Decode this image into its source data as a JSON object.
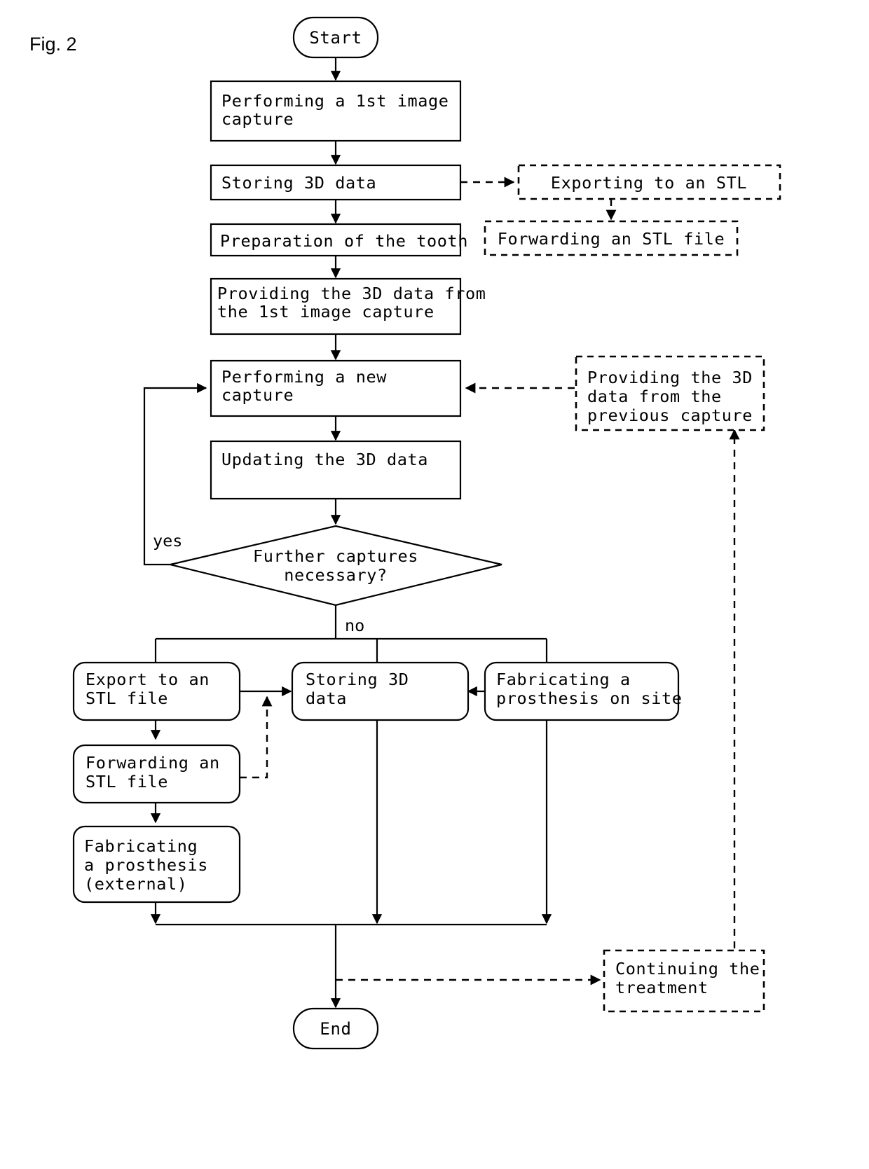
{
  "figure": {
    "label": "Fig. 2",
    "type": "flowchart",
    "title": "Dental 3D capture and prosthesis fabrication workflow"
  },
  "nodes": {
    "start": {
      "label": "Start",
      "shape": "terminator",
      "style": "solid"
    },
    "first_capture": {
      "label": "Performing a 1st image\ncapture",
      "shape": "process",
      "style": "solid"
    },
    "storing_1": {
      "label": "Storing 3D data",
      "shape": "process",
      "style": "solid"
    },
    "exporting_stl": {
      "label": "Exporting to an STL",
      "shape": "process",
      "style": "dashed"
    },
    "preparation": {
      "label": "Preparation of the tooth",
      "shape": "process",
      "style": "solid"
    },
    "forwarding_stl_top": {
      "label": "Forwarding an STL file",
      "shape": "process",
      "style": "dashed"
    },
    "providing_first": {
      "label": "Providing the 3D data from\nthe 1st image capture",
      "shape": "process",
      "style": "solid"
    },
    "new_capture": {
      "label": "Performing a new\ncapture",
      "shape": "process",
      "style": "solid"
    },
    "providing_previous": {
      "label": "Providing the 3D\ndata from the\nprevious capture",
      "shape": "process",
      "style": "dashed"
    },
    "updating": {
      "label": "Updating the 3D data",
      "shape": "process",
      "style": "solid"
    },
    "decision": {
      "label": "Further captures\nnecessary?",
      "shape": "decision",
      "style": "solid"
    },
    "export_stl": {
      "label": "Export to an\nSTL file",
      "shape": "rounded",
      "style": "solid"
    },
    "storing_2": {
      "label": "Storing 3D\ndata",
      "shape": "rounded",
      "style": "solid"
    },
    "fabricating_onsite": {
      "label": "Fabricating a\nprosthesis on site",
      "shape": "rounded",
      "style": "solid"
    },
    "forwarding_stl_bottom": {
      "label": "Forwarding an\nSTL file",
      "shape": "rounded",
      "style": "solid"
    },
    "fabricating_external": {
      "label": "Fabricating\na prosthesis\n(external)",
      "shape": "rounded",
      "style": "solid"
    },
    "continuing": {
      "label": "Continuing the\ntreatment",
      "shape": "process",
      "style": "dashed"
    },
    "end": {
      "label": "End",
      "shape": "terminator",
      "style": "solid"
    }
  },
  "edge_labels": {
    "yes": "yes",
    "no": "no"
  },
  "edges": [
    {
      "from": "start",
      "to": "first_capture",
      "style": "solid"
    },
    {
      "from": "first_capture",
      "to": "storing_1",
      "style": "solid"
    },
    {
      "from": "storing_1",
      "to": "exporting_stl",
      "style": "dashed"
    },
    {
      "from": "storing_1",
      "to": "preparation",
      "style": "solid"
    },
    {
      "from": "exporting_stl",
      "to": "forwarding_stl_top",
      "style": "dashed"
    },
    {
      "from": "preparation",
      "to": "providing_first",
      "style": "solid"
    },
    {
      "from": "providing_first",
      "to": "new_capture",
      "style": "solid"
    },
    {
      "from": "providing_previous",
      "to": "new_capture",
      "style": "dashed"
    },
    {
      "from": "new_capture",
      "to": "updating",
      "style": "solid"
    },
    {
      "from": "updating",
      "to": "decision",
      "style": "solid"
    },
    {
      "from": "decision",
      "to": "new_capture",
      "label": "yes",
      "style": "solid"
    },
    {
      "from": "decision",
      "to": "export_stl",
      "label": "no",
      "style": "solid"
    },
    {
      "from": "decision",
      "to": "storing_2",
      "label": "no",
      "style": "solid"
    },
    {
      "from": "decision",
      "to": "fabricating_onsite",
      "label": "no",
      "style": "solid"
    },
    {
      "from": "export_stl",
      "to": "storing_2",
      "style": "solid"
    },
    {
      "from": "export_stl",
      "to": "forwarding_stl_bottom",
      "style": "solid"
    },
    {
      "from": "forwarding_stl_bottom",
      "to": "storing_2",
      "style": "dashed"
    },
    {
      "from": "forwarding_stl_bottom",
      "to": "fabricating_external",
      "style": "solid"
    },
    {
      "from": "fabricating_onsite",
      "to": "storing_2",
      "style": "solid"
    },
    {
      "from": "fabricating_external",
      "to": "end",
      "style": "solid"
    },
    {
      "from": "storing_2",
      "to": "end",
      "style": "solid"
    },
    {
      "from": "fabricating_onsite",
      "to": "end",
      "style": "solid"
    },
    {
      "from": "end",
      "to": "continuing",
      "style": "dashed"
    },
    {
      "from": "continuing",
      "to": "providing_previous",
      "style": "dashed"
    }
  ],
  "colors": {
    "stroke": "#000000",
    "fill": "#ffffff",
    "background": "#ffffff"
  }
}
